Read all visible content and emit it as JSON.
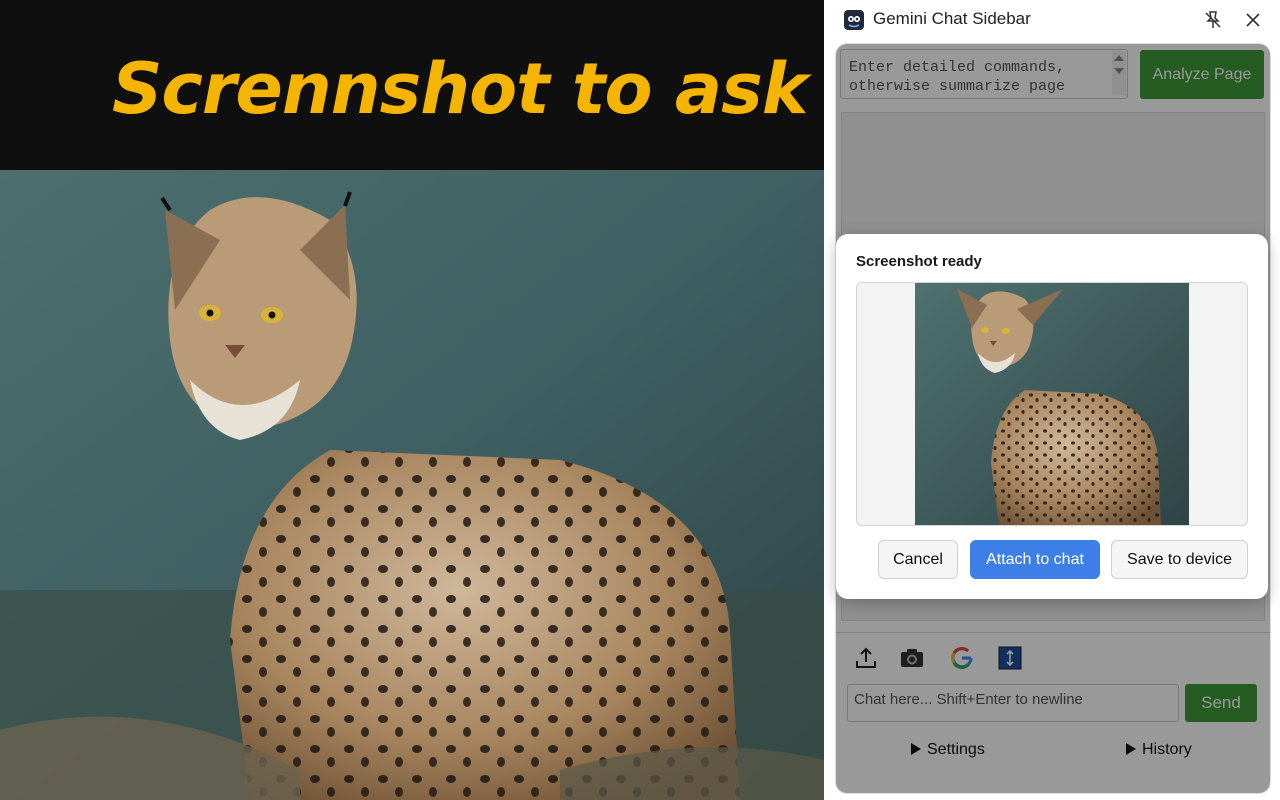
{
  "banner": {
    "title": "Scrennshot to ask"
  },
  "sidebar": {
    "title": "Gemini Chat Sidebar",
    "pin_icon": "pin-off-icon",
    "close_icon": "close-icon",
    "command_input": {
      "placeholder": "Enter detailed commands,\notherwise summarize page\ncontent by default"
    },
    "analyze_button": "Analyze Page",
    "tools": [
      "upload-icon",
      "camera-icon",
      "google-icon",
      "expand-vertical-icon"
    ],
    "chat_input": {
      "placeholder": "Chat here... Shift+Enter to newline"
    },
    "send_button": "Send",
    "settings_toggle": "Settings",
    "history_toggle": "History"
  },
  "modal": {
    "title": "Screenshot ready",
    "cancel_button": "Cancel",
    "attach_button": "Attach to chat",
    "save_button": "Save to device"
  },
  "colors": {
    "banner_text": "#f5b400",
    "accent_green": "#3f9a3a",
    "accent_blue": "#3d7fe6"
  }
}
